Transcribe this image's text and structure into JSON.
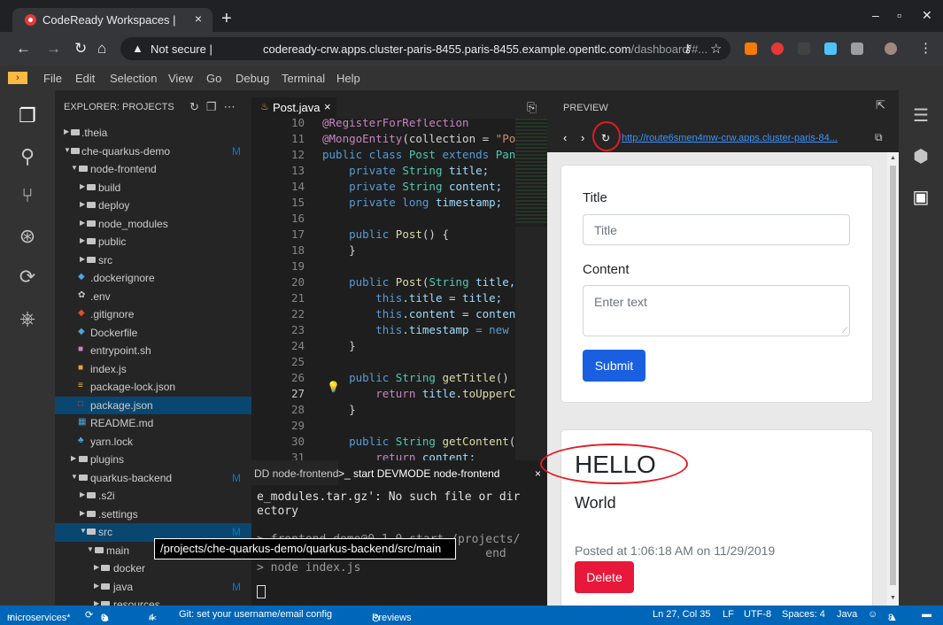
{
  "browser": {
    "tab_title": "CodeReady Workspaces |",
    "tab_close": "×",
    "new_tab": "+",
    "win_min": "–",
    "win_max": "▫",
    "win_close": "✕",
    "security_label": "Not secure",
    "url_host": "codeready-crw.apps.cluster-paris-8455.paris-8455.example.opentlc.com",
    "url_path": "/dashboard/#..."
  },
  "menu": {
    "items": [
      "File",
      "Edit",
      "Selection",
      "View",
      "Go",
      "Debug",
      "Terminal",
      "Help"
    ]
  },
  "explorer": {
    "title": "EXPLORER: PROJECTS",
    "tooltip": "/projects/che-quarkus-demo/quarkus-backend/src/main",
    "items": [
      {
        "label": ".theia",
        "marker": ""
      },
      {
        "label": "che-quarkus-demo",
        "marker": "M"
      },
      {
        "label": "node-frontend",
        "marker": ""
      },
      {
        "label": "build",
        "marker": ""
      },
      {
        "label": "deploy",
        "marker": ""
      },
      {
        "label": "node_modules",
        "marker": ""
      },
      {
        "label": "public",
        "marker": ""
      },
      {
        "label": "src",
        "marker": ""
      },
      {
        "label": ".dockerignore",
        "marker": ""
      },
      {
        "label": ".env",
        "marker": ""
      },
      {
        "label": ".gitignore",
        "marker": ""
      },
      {
        "label": "Dockerfile",
        "marker": ""
      },
      {
        "label": "entrypoint.sh",
        "marker": ""
      },
      {
        "label": "index.js",
        "marker": ""
      },
      {
        "label": "package-lock.json",
        "marker": ""
      },
      {
        "label": "package.json",
        "marker": ""
      },
      {
        "label": "README.md",
        "marker": ""
      },
      {
        "label": "yarn.lock",
        "marker": ""
      },
      {
        "label": "plugins",
        "marker": ""
      },
      {
        "label": "quarkus-backend",
        "marker": "M"
      },
      {
        "label": ".s2i",
        "marker": ""
      },
      {
        "label": ".settings",
        "marker": ""
      },
      {
        "label": "src",
        "marker": "M"
      },
      {
        "label": "main",
        "marker": ""
      },
      {
        "label": "docker",
        "marker": ""
      },
      {
        "label": "java",
        "marker": "M"
      },
      {
        "label": "resources",
        "marker": ""
      }
    ]
  },
  "editor": {
    "tab_label": "Post.java",
    "tab_close": "×",
    "line_numbers": [
      "10",
      "11",
      "12",
      "13",
      "14",
      "15",
      "16",
      "17",
      "18",
      "19",
      "20",
      "21",
      "22",
      "23",
      "24",
      "25",
      "26",
      "27",
      "28",
      "29",
      "30",
      "31"
    ],
    "lines": {
      "l10": "@RegisterForReflection",
      "l11a": "@MongoEntity",
      "l11b": "(collection = ",
      "l11c": "\"Po",
      "l12a": "public class ",
      "l12b": "Post ",
      "l12c": "extends ",
      "l12d": "Pan",
      "l13a": "    private ",
      "l13b": "String ",
      "l13c": "title;",
      "l14a": "    private ",
      "l14b": "String ",
      "l14c": "content;",
      "l15a": "    private long ",
      "l15b": "timestamp;",
      "l17a": "    public ",
      "l17b": "Post",
      "l17c": "() {",
      "l18": "    }",
      "l20a": "    public ",
      "l20b": "Post",
      "l20c": "(",
      "l20d": "String ",
      "l20e": "title,",
      "l21a": "        this",
      "l21b": ".title",
      "l21c": " = ",
      "l21d": "title;",
      "l22a": "        this",
      "l22b": ".content",
      "l22c": " = ",
      "l22d": "conten",
      "l23a": "        this",
      "l23b": ".timestamp",
      "l23c": " = new",
      "l24": "    }",
      "l26a": "    public ",
      "l26b": "String ",
      "l26c": "getTitle",
      "l26d": "()",
      "l27a": "        return ",
      "l27b": "title",
      "l27c": ".",
      "l27d": "toUpperC",
      "l28": "    }",
      "l30a": "    public ",
      "l30b": "String ",
      "l30c": "getContent",
      "l30d": "(",
      "l31a": "        return ",
      "l31b": "content;"
    }
  },
  "terminal": {
    "tab1": "DD node-frontend",
    "tab2": ">_ start DEVMODE node-frontend",
    "tab2_close": "×",
    "lines": [
      "e_modules.tar.gz': No such file or dir",
      "ectory",
      "",
      "> frontend-demo@0.1.0 start /projects/",
      "                                 end",
      "> node index.js"
    ]
  },
  "preview": {
    "title": "PREVIEW",
    "url": "http://route6smen4mw-crw.apps.cluster-paris-84...",
    "form": {
      "title_label": "Title",
      "title_placeholder": "Title",
      "content_label": "Content",
      "content_placeholder": "Enter text",
      "submit_label": "Submit"
    },
    "post": {
      "title": "HELLO",
      "content": "World",
      "posted": "Posted at 1:06:18 AM on 11/29/2019",
      "delete_label": "Delete"
    }
  },
  "status": {
    "branch": "microservices*",
    "errors": "0",
    "warnings": "9",
    "tools": "4",
    "git_msg": "Git: set your username/email config",
    "previews": "Previews",
    "cursor": "Ln 27, Col 35",
    "eol": "LF",
    "encoding": "UTF-8",
    "spaces": "Spaces: 4",
    "language": "Java",
    "notifications": "8"
  }
}
